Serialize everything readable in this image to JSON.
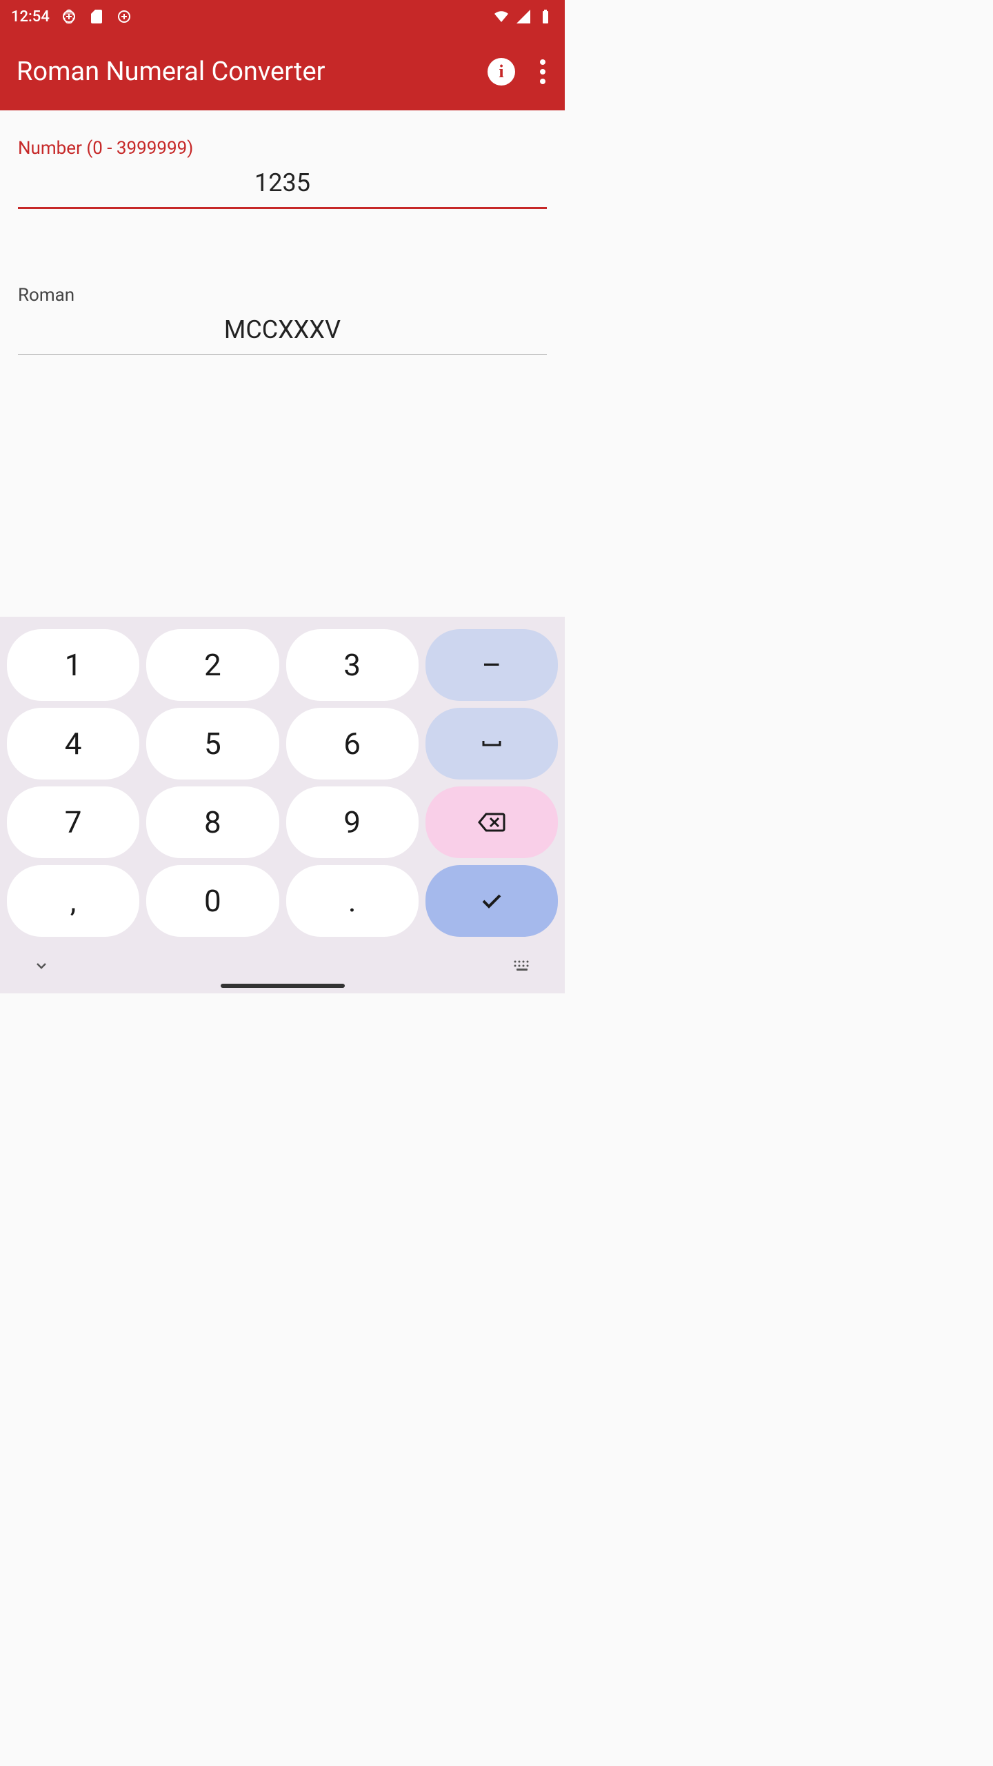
{
  "status": {
    "time": "12:54"
  },
  "appbar": {
    "title": "Roman Numeral Converter"
  },
  "fields": {
    "number_label": "Number (0 - 3999999)",
    "number_value": "1235",
    "roman_label": "Roman",
    "roman_value": "MCCXXXV"
  },
  "keyboard": {
    "keys": [
      "1",
      "2",
      "3",
      "–",
      "4",
      "5",
      "6",
      "",
      "7",
      "8",
      "9",
      "",
      ",",
      "0",
      ".",
      ""
    ]
  }
}
